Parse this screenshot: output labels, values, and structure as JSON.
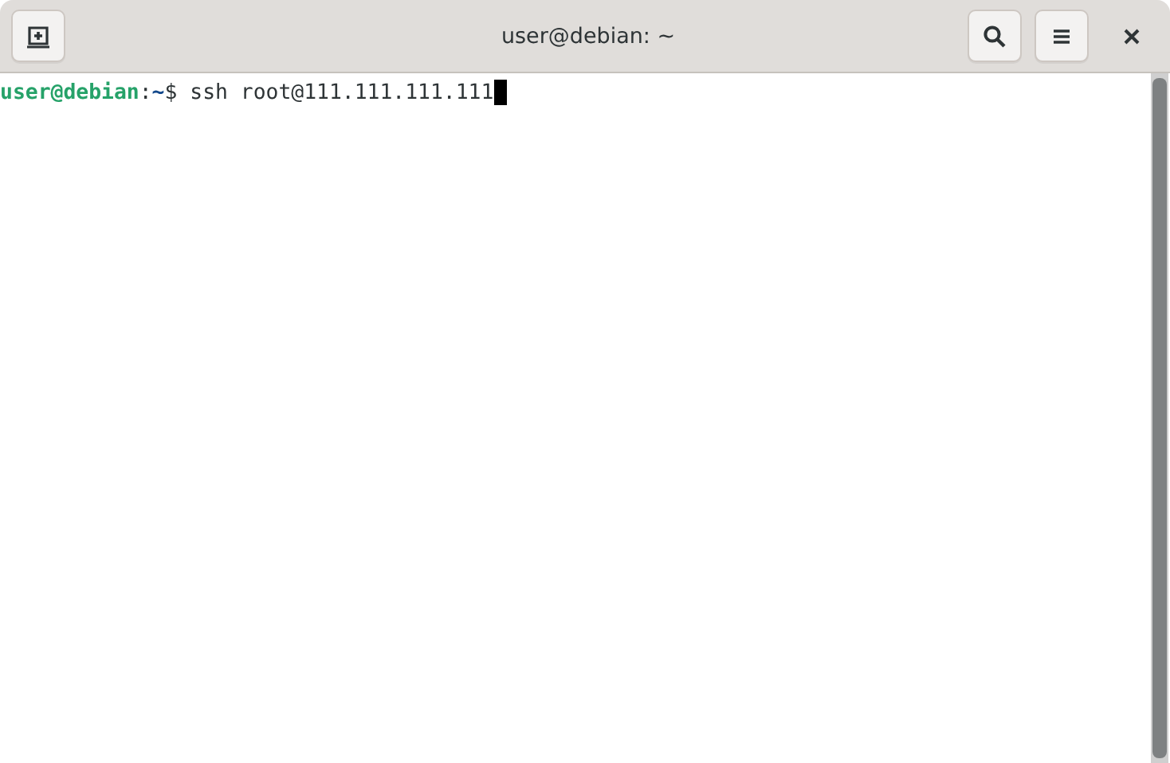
{
  "window": {
    "title": "user@debian: ~"
  },
  "terminal": {
    "lines": [
      {
        "user_host": "user@debian",
        "separator": ":",
        "path": "~",
        "symbol": "$",
        "command": " ssh root@111.111.111.111",
        "cursor": true
      }
    ]
  }
}
